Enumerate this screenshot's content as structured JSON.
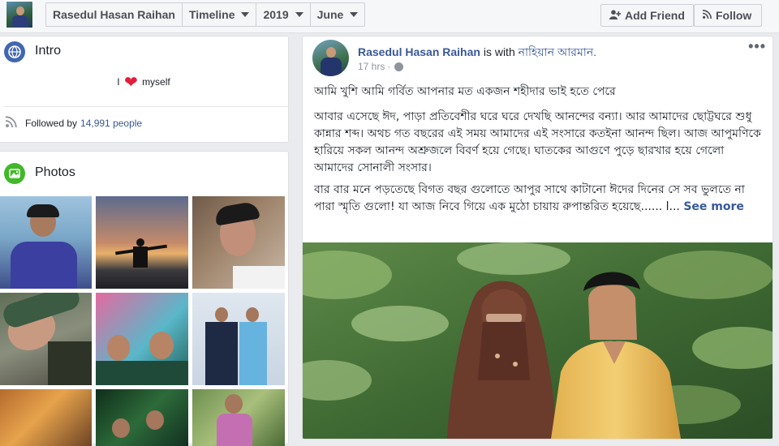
{
  "topbar": {
    "profile_name": "Rasedul Hasan Raihan",
    "timeline_label": "Timeline",
    "year_label": "2019",
    "month_label": "June",
    "add_friend_label": "Add Friend",
    "follow_label": "Follow"
  },
  "intro": {
    "title": "Intro",
    "bio_prefix": "I",
    "bio_suffix": "myself",
    "followed_prefix": "Followed by",
    "followed_count": "14,991 people"
  },
  "photos": {
    "title": "Photos"
  },
  "post": {
    "author": "Rasedul Hasan Raihan",
    "with_text": "is with",
    "tagged": "নাহিয়ান আরমান.",
    "time": "17 hrs",
    "paragraph1": "আমি খুশি আমি গর্বিত আপনার মত একজন শহীদার ভাই হতে পেরে",
    "paragraph2": "আবার এসেছে ঈদ, পাড়া প্রতিবেশীর ঘরে ঘরে দেখছি আনন্দের বন্যা। আর আমাদের ছোট্টঘরে শুধু কান্নার শব্দ। অথচ গত বছরের এই সময় আমাদের এই সংসারে কতইনা আনন্দ ছিল। আজ আপুমণিকে হারিয়ে সকল আনন্দ অশ্রুজলে বিবর্ণ হয়ে গেছে। ঘাতকের আগুণে পুড়ে ছারখার হয়ে গেলো আমাদের সোনালী সংসার।",
    "paragraph3": "বার বার মনে পড়তেছে বিগত বছর গুলোতে আপুর সাথে কাটানো ঈদের দিনের সে সব ভুলতে না পারা স্মৃতি গুলো! যা আজ নিবে গিয়ে এক মুঠো চায়ায় রুপান্তরিত হয়েছে...... l...",
    "see_more": "See more"
  },
  "colors": {
    "link": "#385898",
    "heart": "#e0203a",
    "intro_icon": "#4267b2",
    "photos_icon": "#42b72a"
  },
  "icons": {
    "intro": "globe-icon",
    "photos": "photos-icon",
    "followers": "rss-icon",
    "add_friend": "add-friend-icon",
    "follow": "rss-icon"
  }
}
